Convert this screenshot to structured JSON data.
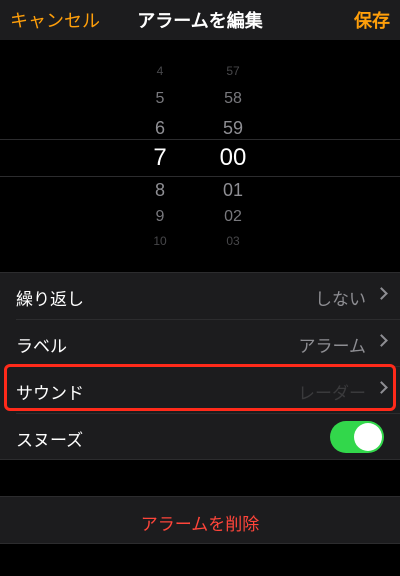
{
  "nav": {
    "cancel_label": "キャンセル",
    "title": "アラームを編集",
    "save_label": "保存"
  },
  "picker": {
    "hours": [
      "4",
      "5",
      "6",
      "7",
      "8",
      "9",
      "10"
    ],
    "minutes": [
      "57",
      "58",
      "59",
      "00",
      "01",
      "02",
      "03"
    ],
    "selected_hour": "7",
    "selected_minute": "00"
  },
  "settings": {
    "repeat": {
      "label": "繰り返し",
      "value": "しない"
    },
    "label": {
      "label": "ラベル",
      "value": "アラーム"
    },
    "sound": {
      "label": "サウンド",
      "value": "レーダー"
    },
    "snooze": {
      "label": "スヌーズ",
      "enabled": true
    }
  },
  "delete_label": "アラームを削除",
  "colors": {
    "accent": "#ff9f0a",
    "destructive": "#ff453a",
    "toggle_on": "#32d74b",
    "highlight_box": "#ff2a1a"
  }
}
